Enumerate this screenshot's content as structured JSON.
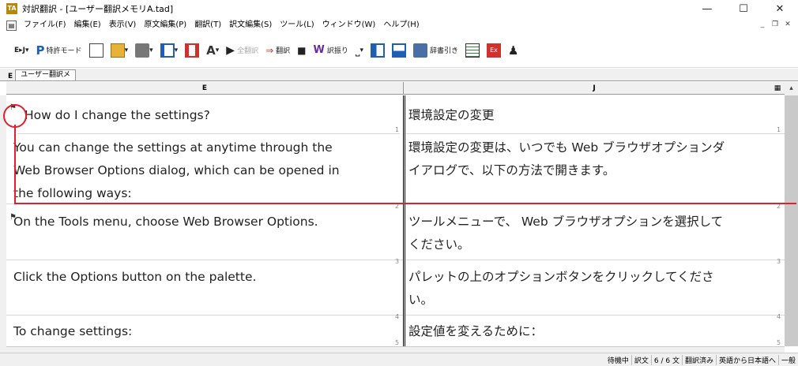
{
  "window": {
    "title": "対訳翻訳 - [ユーザー翻訳メモリA.tad]",
    "app_icon": "TA"
  },
  "menu": [
    "ファイル(F)",
    "編集(E)",
    "表示(V)",
    "原文編集(P)",
    "翻訳(T)",
    "訳文編集(S)",
    "ツール(L)",
    "ウィンドウ(W)",
    "ヘルプ(H)"
  ],
  "toolbar": {
    "lang": "E▸J",
    "patent": "特許モード",
    "translate_all": "全翻訳",
    "translate": "翻訳",
    "tag": "訳振り",
    "dict": "辞書引き"
  },
  "tab": {
    "label": "ユーザー翻訳メ",
    "letter": "E"
  },
  "columns": {
    "left": "E",
    "right": "J"
  },
  "rows": [
    {
      "en": "How do I change the settings?",
      "ja": "環境設定の変更",
      "num": "1"
    },
    {
      "en": [
        "You can change the settings at anytime through the",
        "Web Browser Options dialog, which can be opened in",
        "the following ways:"
      ],
      "ja": [
        "環境設定の変更は、いつでも Web ブラウザオプションダ",
        "イアログで、以下の方法で開きます。"
      ],
      "num": "1"
    },
    {
      "en": "On the Tools menu, choose Web Browser  Options.",
      "ja": [
        "ツールメニューで、 Web ブラウザオプションを選択して",
        "ください。"
      ],
      "num": "2"
    },
    {
      "en": "Click the Options button on the palette.",
      "ja": [
        "パレットの上のオプションボタンをクリックしてくださ",
        "い。"
      ],
      "num": "3"
    },
    {
      "en": "To change settings:",
      "ja": "設定値を変えるために：",
      "num": "4"
    }
  ],
  "status": [
    "待機中",
    "訳文",
    "6 / 6 文",
    "翻訳済み",
    "英語から日本語へ",
    "一般"
  ]
}
